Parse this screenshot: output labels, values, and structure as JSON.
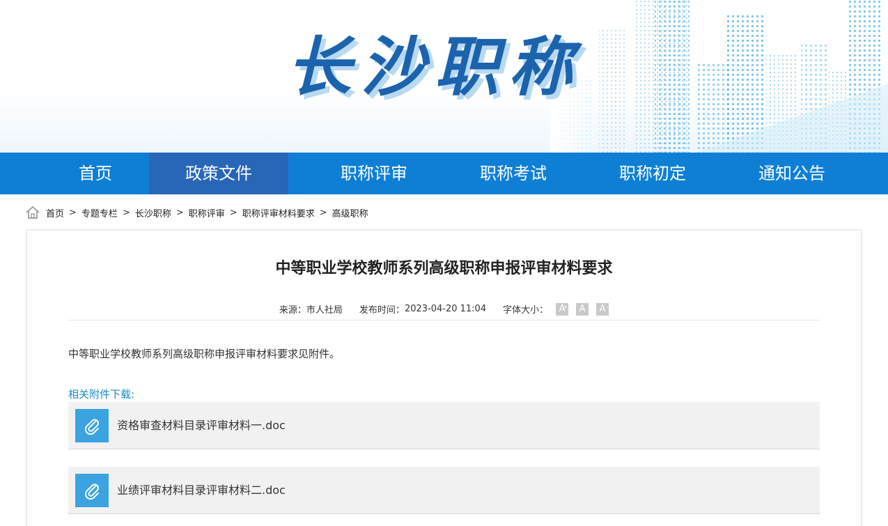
{
  "site": {
    "title": "长沙职称"
  },
  "nav": {
    "items": [
      {
        "label": "首页",
        "active": false
      },
      {
        "label": "政策文件",
        "active": true
      },
      {
        "label": "职称评审",
        "active": false
      },
      {
        "label": "职称考试",
        "active": false
      },
      {
        "label": "职称初定",
        "active": false
      },
      {
        "label": "通知公告",
        "active": false
      }
    ]
  },
  "breadcrumb": {
    "items": [
      "首页",
      "专题专栏",
      "长沙职称",
      "职称评审",
      "职称评审材料要求",
      "高级职称"
    ],
    "separator": ">"
  },
  "article": {
    "title": "中等职业学校教师系列高级职称申报评审材料要求",
    "source_label": "来源：",
    "source_value": "市人社局",
    "date_label": "发布时间：",
    "date_value": "2023-04-20 11:04",
    "fontsize_label": "字体大小：",
    "body": "中等职业学校教师系列高级职称申报评审材料要求见附件。",
    "attachments_heading": "相关附件下载:",
    "attachments": [
      {
        "name": "资格审查材料目录评审材料一.doc",
        "icon": "paperclip-icon"
      },
      {
        "name": "业绩评审材料目录评审材料二.doc",
        "icon": "paperclip-icon"
      }
    ]
  },
  "colors": {
    "nav_bg": "#0f7fd6",
    "nav_active": "#2866b8",
    "title_blue": "#1b63ad",
    "link_blue": "#1a8ac9",
    "attach_icon_bg": "#3aa3e0"
  }
}
